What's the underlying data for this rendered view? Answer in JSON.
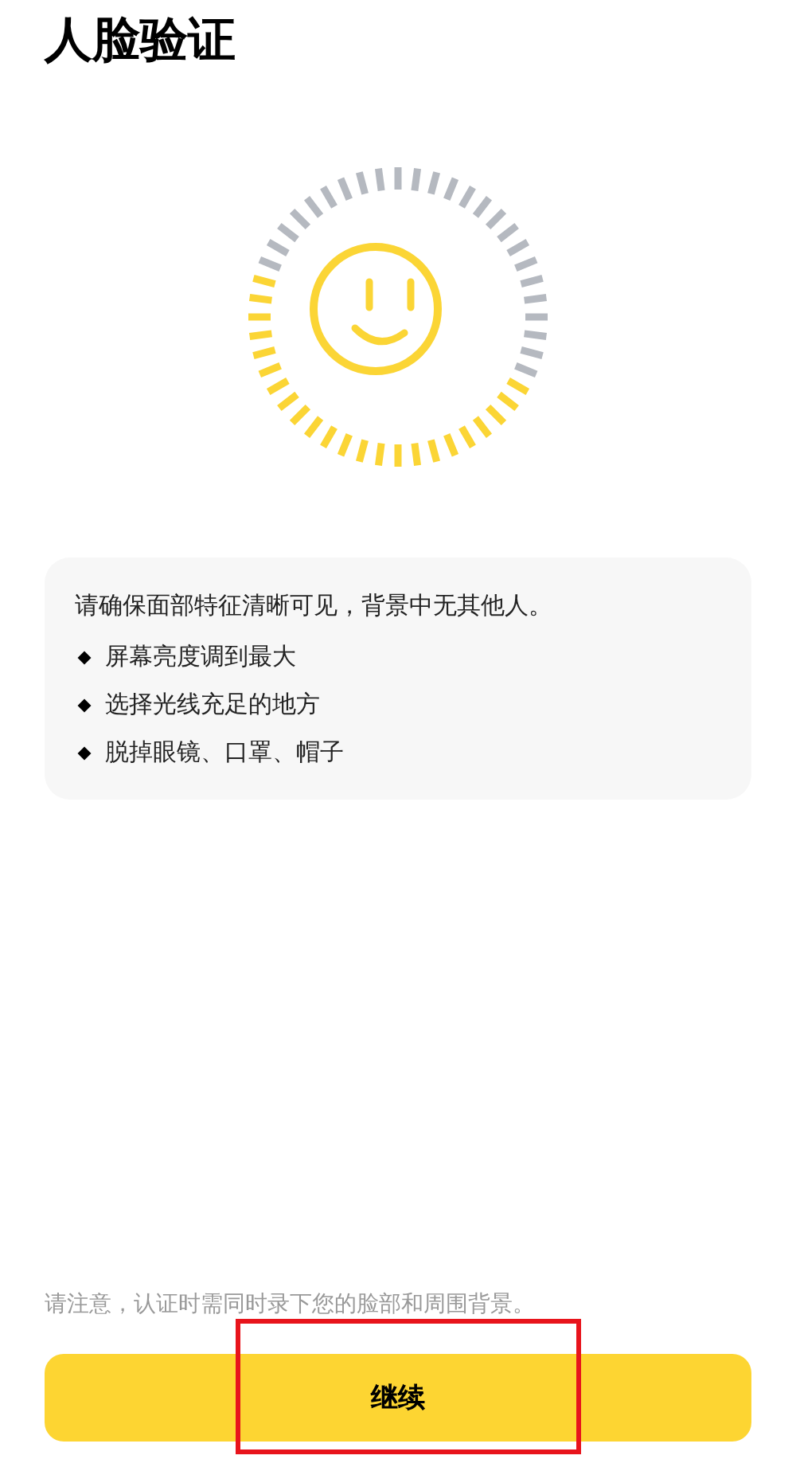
{
  "title": "人脸验证",
  "tips": {
    "heading": "请确保面部特征清晰可见，背景中无其他人。",
    "items": [
      "屏幕亮度调到最大",
      "选择光线充足的地方",
      "脱掉眼镜、口罩、帽子"
    ]
  },
  "notice": "请注意，认证时需同时录下您的脸部和周围背景。",
  "button": {
    "label": "继续"
  }
}
